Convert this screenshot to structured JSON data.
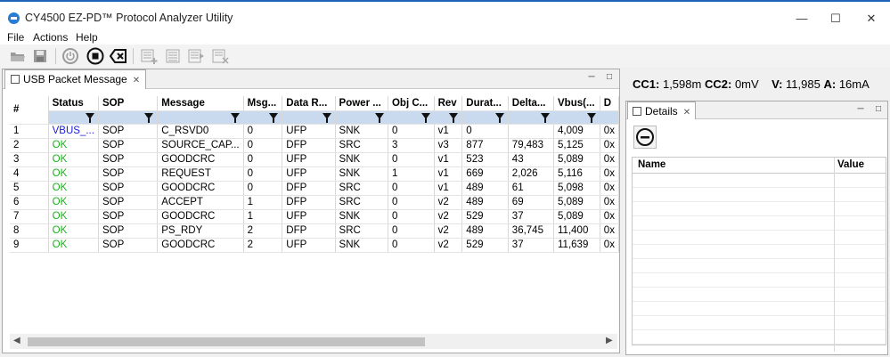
{
  "window": {
    "title": "CY4500 EZ-PD™ Protocol Analyzer Utility"
  },
  "menu": [
    "File",
    "Actions",
    "Help"
  ],
  "toolbar": {
    "icons": [
      "open-folder-icon",
      "save-icon",
      "power-icon",
      "stop-icon",
      "clear-icon",
      "add-filter-icon",
      "filter-list-icon",
      "filter-apply-icon",
      "filter-clear-icon"
    ]
  },
  "packet_panel": {
    "tab_label": "USB Packet Message",
    "columns": [
      "#",
      "Status",
      "SOP",
      "Message",
      "Msg...",
      "Data R...",
      "Power ...",
      "Obj C...",
      "Rev",
      "Durat...",
      "Delta...",
      "Vbus(...",
      "D"
    ],
    "rows": [
      [
        "1",
        "VBUS_...",
        "SOP",
        "C_RSVD0",
        "0",
        "UFP",
        "SNK",
        "0",
        "v1",
        "0",
        "",
        "4,009",
        "0x"
      ],
      [
        "2",
        "OK",
        "SOP",
        "SOURCE_CAP...",
        "0",
        "DFP",
        "SRC",
        "3",
        "v3",
        "877",
        "79,483",
        "5,125",
        "0x"
      ],
      [
        "3",
        "OK",
        "SOP",
        "GOODCRC",
        "0",
        "UFP",
        "SNK",
        "0",
        "v1",
        "523",
        "43",
        "5,089",
        "0x"
      ],
      [
        "4",
        "OK",
        "SOP",
        "REQUEST",
        "0",
        "UFP",
        "SNK",
        "1",
        "v1",
        "669",
        "2,026",
        "5,116",
        "0x"
      ],
      [
        "5",
        "OK",
        "SOP",
        "GOODCRC",
        "0",
        "DFP",
        "SRC",
        "0",
        "v1",
        "489",
        "61",
        "5,098",
        "0x"
      ],
      [
        "6",
        "OK",
        "SOP",
        "ACCEPT",
        "1",
        "DFP",
        "SRC",
        "0",
        "v2",
        "489",
        "69",
        "5,089",
        "0x"
      ],
      [
        "7",
        "OK",
        "SOP",
        "GOODCRC",
        "1",
        "UFP",
        "SNK",
        "0",
        "v2",
        "529",
        "37",
        "5,089",
        "0x"
      ],
      [
        "8",
        "OK",
        "SOP",
        "PS_RDY",
        "2",
        "DFP",
        "SRC",
        "0",
        "v2",
        "489",
        "36,745",
        "11,400",
        "0x"
      ],
      [
        "9",
        "OK",
        "SOP",
        "GOODCRC",
        "2",
        "UFP",
        "SNK",
        "0",
        "v2",
        "529",
        "37",
        "11,639",
        "0x"
      ]
    ]
  },
  "status": {
    "cc1_label": "CC1:",
    "cc1_value": "1,598m",
    "cc2_label": "CC2:",
    "cc2_value": "0mV",
    "v_label": "V:",
    "v_value": "11,985",
    "a_label": "A:",
    "a_value": "16mA"
  },
  "details_panel": {
    "tab_label": "Details",
    "columns": [
      "Name",
      "Value"
    ]
  },
  "colors": {
    "ok": "#17b517",
    "vbus": "#1a1ae0",
    "filter_row": "#c9d9ee",
    "titlebar_accent": "#1f63b8"
  }
}
